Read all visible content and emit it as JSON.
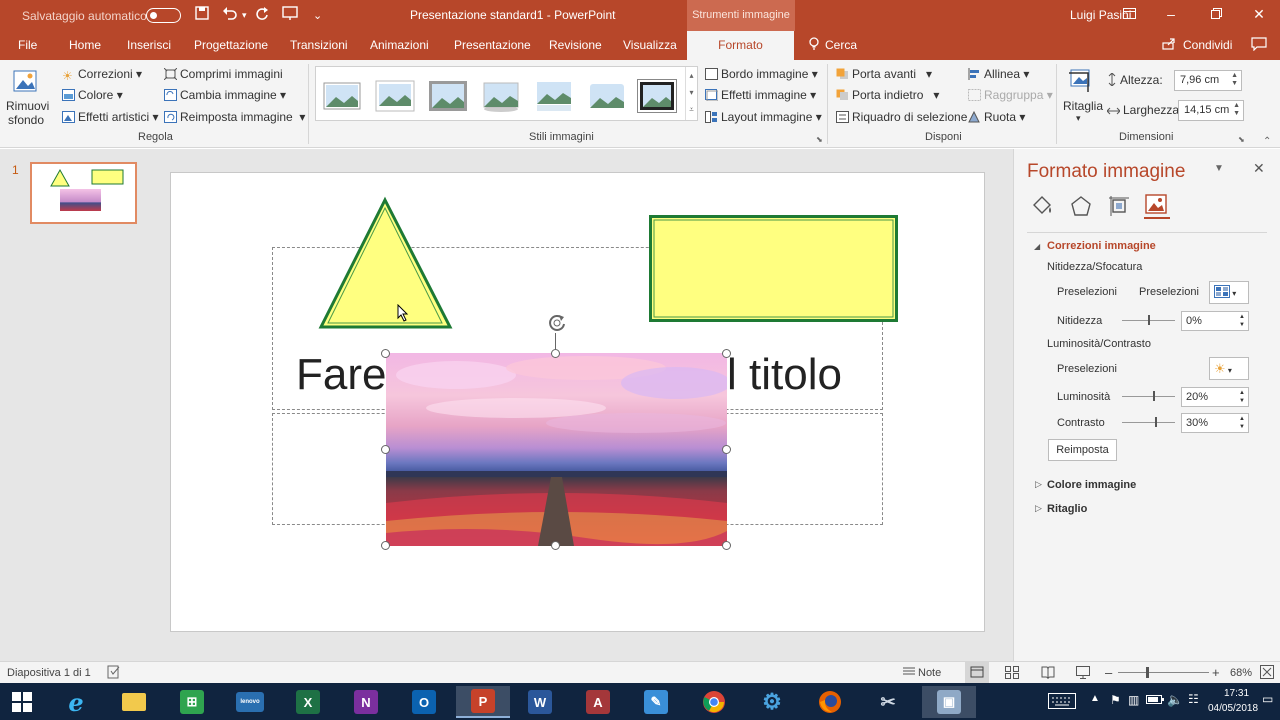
{
  "titlebar": {
    "autosave_label": "Salvataggio automatico",
    "document_title": "Presentazione standard1  -  PowerPoint",
    "contextual_group": "Strumenti immagine",
    "user_name": "Luigi Pasini"
  },
  "tabs": [
    {
      "label": "File"
    },
    {
      "label": "Home"
    },
    {
      "label": "Inserisci"
    },
    {
      "label": "Progettazione"
    },
    {
      "label": "Transizioni"
    },
    {
      "label": "Animazioni"
    },
    {
      "label": "Presentazione"
    },
    {
      "label": "Revisione"
    },
    {
      "label": "Visualizza"
    },
    {
      "label": "Formato",
      "active": true
    }
  ],
  "tell_me": "Cerca",
  "share": "Condividi",
  "ribbon": {
    "remove_bg": [
      "Rimuovi",
      "sfondo"
    ],
    "adjust": {
      "corrections": "Correzioni",
      "color": "Colore",
      "artistic": "Effetti artistici",
      "compress": "Comprimi immagini",
      "change": "Cambia immagine",
      "reset": "Reimposta immagine",
      "group_label": "Regola"
    },
    "styles_group_label": "Stili immagini",
    "picture_border": "Bordo immagine",
    "picture_effects": "Effetti immagine",
    "picture_layout": "Layout immagine",
    "arrange": {
      "bring_forward": "Porta avanti",
      "send_backward": "Porta indietro",
      "selection_pane": "Riquadro di selezione",
      "align": "Allinea",
      "group": "Raggruppa",
      "rotate": "Ruota",
      "group_label": "Disponi"
    },
    "crop": "Ritaglia",
    "size": {
      "height_label": "Altezza:",
      "height_value": "7,96 cm",
      "width_label": "Larghezza:",
      "width_value": "14,15 cm",
      "group_label": "Dimensioni"
    }
  },
  "slides": {
    "number": "1"
  },
  "slide": {
    "title_left": "Fare",
    "title_right": "l titolo"
  },
  "format_pane": {
    "title": "Formato immagine",
    "section_corrections": "Correzioni immagine",
    "sharpen_soften": "Nitidezza/Sfocatura",
    "presets": "Preselezioni",
    "presets_label2": "Preselezioni",
    "sharpness": "Nitidezza",
    "sharpness_value": "0%",
    "brightness_contrast": "Luminosità/Contrasto",
    "presets_bc": "Preselezioni",
    "brightness": "Luminosità",
    "brightness_value": "20%",
    "contrast": "Contrasto",
    "contrast_value": "30%",
    "reset": "Reimposta",
    "section_color": "Colore immagine",
    "section_crop": "Ritaglio"
  },
  "status": {
    "slide_info": "Diapositiva 1 di 1",
    "notes": "Note",
    "zoom": "68%"
  },
  "taskbar": {
    "time": "17:31",
    "date": "04/05/2018"
  },
  "colors": {
    "brand": "#b7472a",
    "shape_fill": "#ffff80",
    "shape_border": "#1e7a34"
  }
}
